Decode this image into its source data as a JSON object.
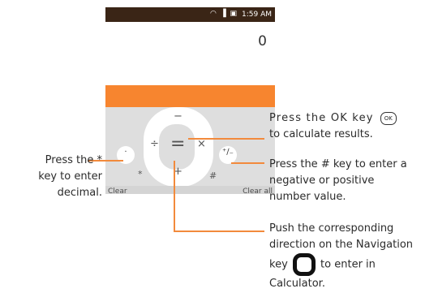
{
  "status_bar": {
    "icons": "◠ ▐ ▣",
    "time": "1:59 AM"
  },
  "display": {
    "value": "0"
  },
  "keypad": {
    "minus": "−",
    "divide": "÷",
    "equals": "=",
    "multiply": "×",
    "plus": "+",
    "dot": "·",
    "sign": "⁺∕₋",
    "star_hint": "*",
    "hash_hint": "#"
  },
  "softkeys": {
    "left": "Clear",
    "right": "Clear all"
  },
  "callouts": {
    "ok_line1": "Press  the  OK  key",
    "ok_icon": "OK",
    "ok_line2": "to  calculate results.",
    "hash_line1": "Press the # key to enter a",
    "hash_line2": "negative or positive",
    "hash_line3": "number value.",
    "star_line1": "Press the *",
    "star_line2": "key to enter",
    "star_line3": "decimal.",
    "nav_line1": "Push the corresponding",
    "nav_line2": "direction on the Navigation",
    "nav_line3a": "key",
    "nav_line3b": "to enter in",
    "nav_line4": "Calculator."
  },
  "colors": {
    "accent": "#f7852f",
    "status_bar": "#3a2516",
    "keypad_bg": "#dedede"
  }
}
